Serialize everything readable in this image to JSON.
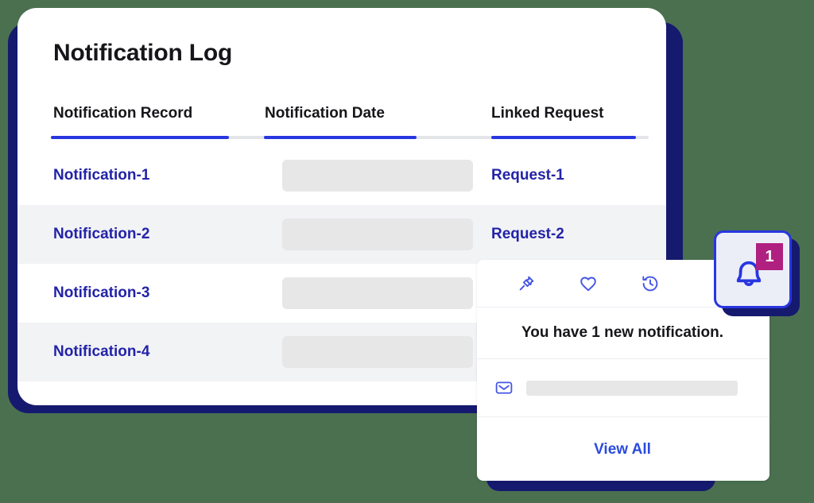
{
  "theme": {
    "background": "#4a7050",
    "card_bg": "#ffffff",
    "shadow_navy": "#151a6e",
    "accent_blue": "#2836e0",
    "link_navy": "#2323a8",
    "link_blue": "#2b4bdd",
    "badge_magenta": "#b02080",
    "placeholder_gray": "#e7e7e8",
    "alt_row_gray": "#f2f3f5",
    "bell_button_bg": "#eceef7"
  },
  "main_card": {
    "title": "Notification Log",
    "table": {
      "columns": [
        {
          "key": "record",
          "label": "Notification Record"
        },
        {
          "key": "date",
          "label": "Notification Date"
        },
        {
          "key": "request",
          "label": "Linked Request"
        }
      ],
      "rows": [
        {
          "record": "Notification-1",
          "date": "",
          "request": "Request-1"
        },
        {
          "record": "Notification-2",
          "date": "",
          "request": "Request-2"
        },
        {
          "record": "Notification-3",
          "date": "",
          "request": ""
        },
        {
          "record": "Notification-4",
          "date": "",
          "request": ""
        }
      ]
    }
  },
  "notification_popup": {
    "toolbar": [
      {
        "name": "pin-icon",
        "label": "Pin"
      },
      {
        "name": "heart-icon",
        "label": "Favorite"
      },
      {
        "name": "history-icon",
        "label": "History"
      }
    ],
    "message": "You have 1 new notification.",
    "item": {
      "icon": "envelope-icon",
      "text": ""
    },
    "footer_link": "View All"
  },
  "bell_button": {
    "icon": "bell-icon",
    "badge_count": "1"
  }
}
